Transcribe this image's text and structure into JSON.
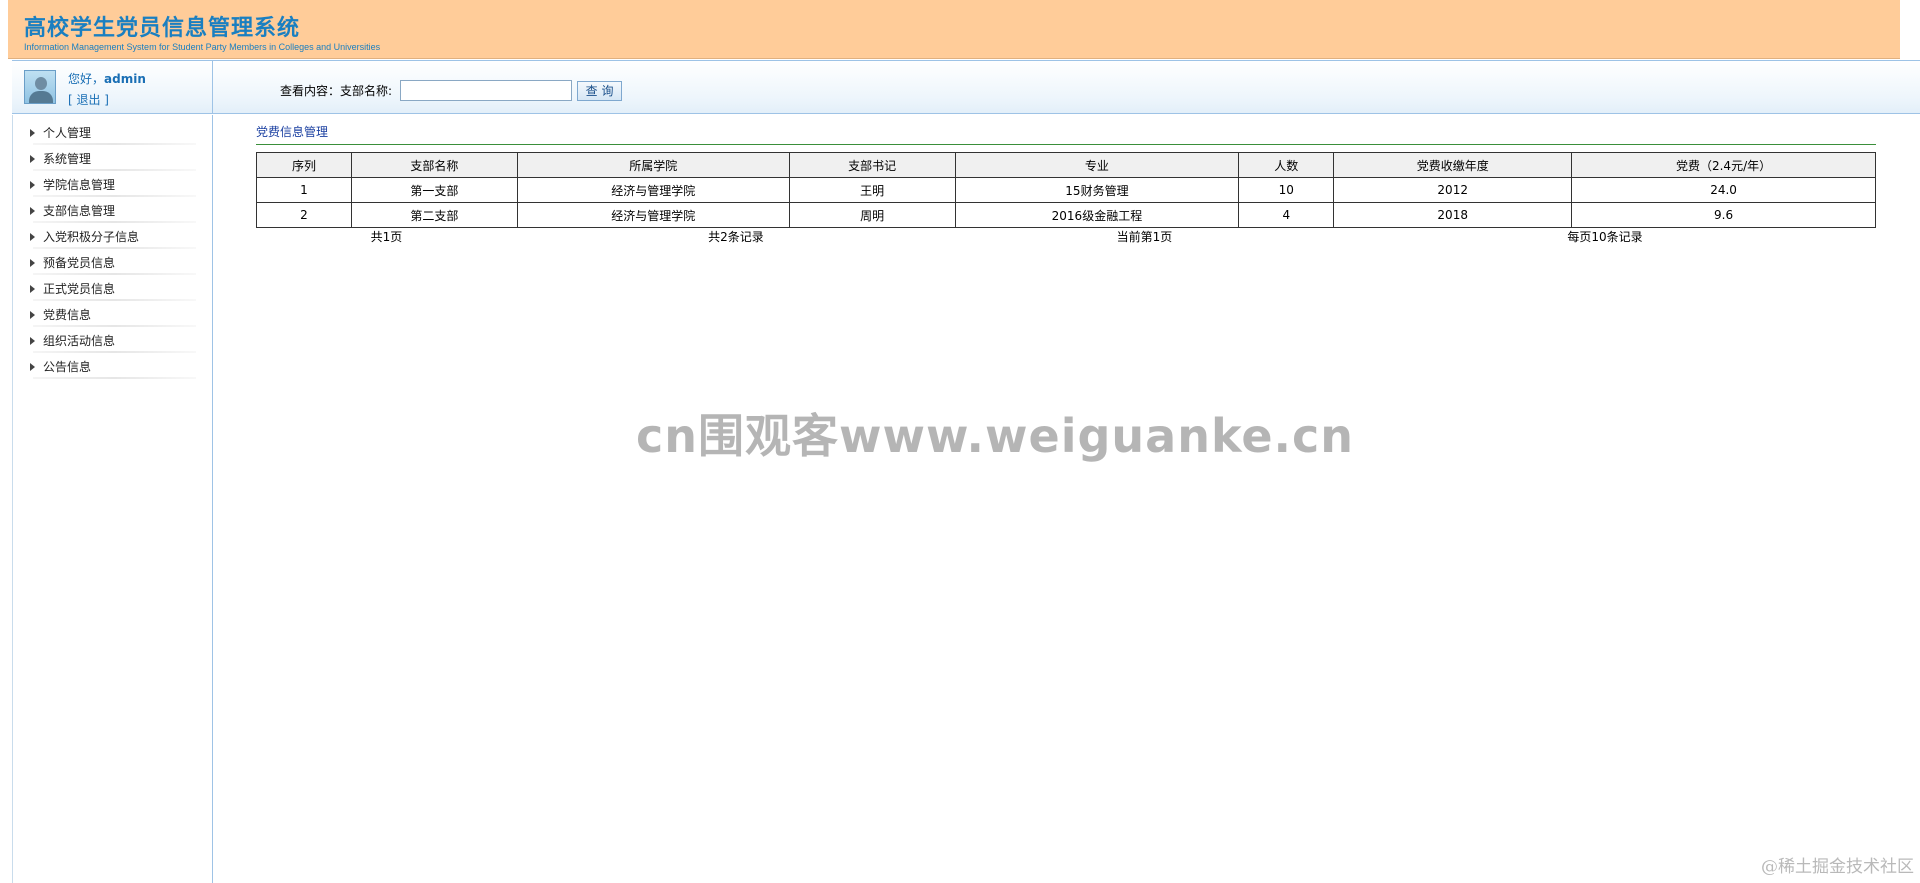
{
  "header": {
    "title": "高校学生党员信息管理系统",
    "subtitle": "Information Management System for Student Party Members in Colleges and Universities"
  },
  "user": {
    "greeting": "您好，",
    "name": "admin",
    "logout": "[ 退出 ]"
  },
  "search": {
    "label": "查看内容：支部名称:",
    "value": "",
    "placeholder": "",
    "button": "查 询"
  },
  "sidebar": {
    "items": [
      {
        "label": "个人管理"
      },
      {
        "label": "系统管理"
      },
      {
        "label": "学院信息管理"
      },
      {
        "label": "支部信息管理"
      },
      {
        "label": "入党积极分子信息"
      },
      {
        "label": "预备党员信息"
      },
      {
        "label": "正式党员信息"
      },
      {
        "label": "党费信息"
      },
      {
        "label": "组织活动信息"
      },
      {
        "label": "公告信息"
      }
    ]
  },
  "main": {
    "section_title": "党费信息管理",
    "table": {
      "headers": [
        "序列",
        "支部名称",
        "所属学院",
        "支部书记",
        "专业",
        "人数",
        "党费收缴年度",
        "党费（2.4元/年）"
      ],
      "rows": [
        [
          "1",
          "第一支部",
          "经济与管理学院",
          "王明",
          "15财务管理",
          "10",
          "2012",
          "24.0"
        ],
        [
          "2",
          "第二支部",
          "经济与管理学院",
          "周明",
          "2016级金融工程",
          "4",
          "2018",
          "9.6"
        ]
      ]
    },
    "pager": {
      "total_pages": "共1页",
      "total_records": "共2条记录",
      "current_page": "当前第1页",
      "per_page": "每页10条记录"
    }
  },
  "watermark": "cn围观客www.weiguanke.cn",
  "corner_text": "@稀土掘金技术社区",
  "colors": {
    "header_bg": "#ffcc99",
    "title_color": "#1a7fc1",
    "border_blue": "#9ec3e6",
    "section_line": "#3a8f3a"
  }
}
